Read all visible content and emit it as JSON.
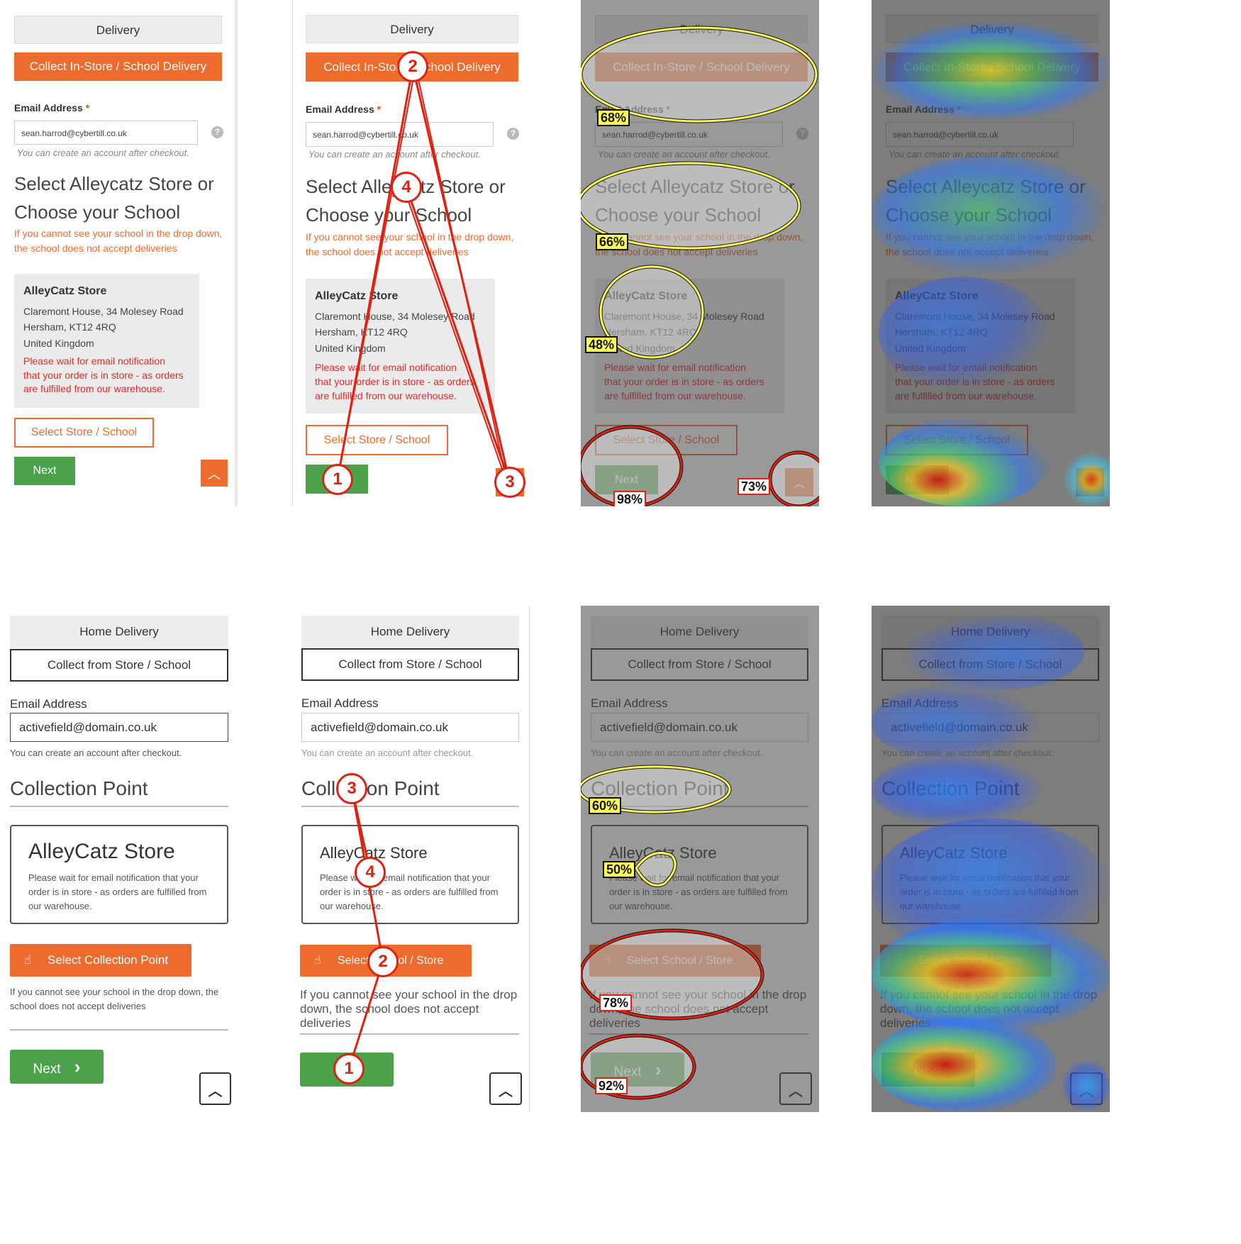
{
  "top": {
    "tab_delivery": "Delivery",
    "tab_collect": "Collect In-Store / School Delivery",
    "email_label": "Email Address",
    "required_mark": "*",
    "email_value": "sean.harrod@cybertill.co.uk",
    "help_glyph": "?",
    "email_hint": "You can create an account after checkout.",
    "heading_line1": "Select Alleycatz Store or",
    "heading_line2": "Choose your School",
    "warn_line1": "If you cannot see your school in the drop down,",
    "warn_line2": "the school does not accept deliveries",
    "store_name": "AlleyCatz Store",
    "addr1": "Claremont House, 34 Molesey Road",
    "addr2": "Hersham, KT12 4RQ",
    "addr3": "United Kingdom",
    "notice1": "Please wait for email notification",
    "notice2": "that your order is in store - as orders",
    "notice3": "are fulfilled from our warehouse.",
    "select_btn": "Select Store / School",
    "next_btn": "Next",
    "up_glyph": "︿",
    "gaze_order": [
      "1",
      "2",
      "3",
      "4"
    ],
    "attention": {
      "tabs": "68%",
      "heading": "66%",
      "store": "48%",
      "next": "98%",
      "scroll": "73%"
    }
  },
  "bottom": {
    "tab_home": "Home Delivery",
    "tab_collect": "Collect from Store / School",
    "email_label": "Email Address",
    "email_value": "activefield@domain.co.uk",
    "email_hint": "You can create an account after checkout.",
    "heading": "Collection Point",
    "store_name": "AlleyCatz Store",
    "notice1": "Please wait for email notification that your",
    "notice2": "order is in store - as orders are fulfilled from",
    "notice3": "our warehouse.",
    "select_btn_original": "Select Collection Point",
    "select_btn": "Select School / Store",
    "small_warn1": "If you cannot see your school in the drop down, the",
    "small_warn2": "school does not accept deliveries",
    "big_warn1": "If you cannot see your school in the drop",
    "big_warn2": "down, the school does not accept deliveries",
    "next_btn": "Next",
    "next_chevron": "›",
    "hand_glyph": "☝",
    "up_glyph": "︿",
    "gaze_order": [
      "1",
      "2",
      "3",
      "4"
    ],
    "attention": {
      "heading": "60%",
      "store": "50%",
      "select": "78%",
      "next": "92%"
    }
  },
  "colors": {
    "orange": "#ee6b2e",
    "green": "#4ba24a",
    "gaze_red": "#d21",
    "aoi_yellow": "#fffb57"
  }
}
